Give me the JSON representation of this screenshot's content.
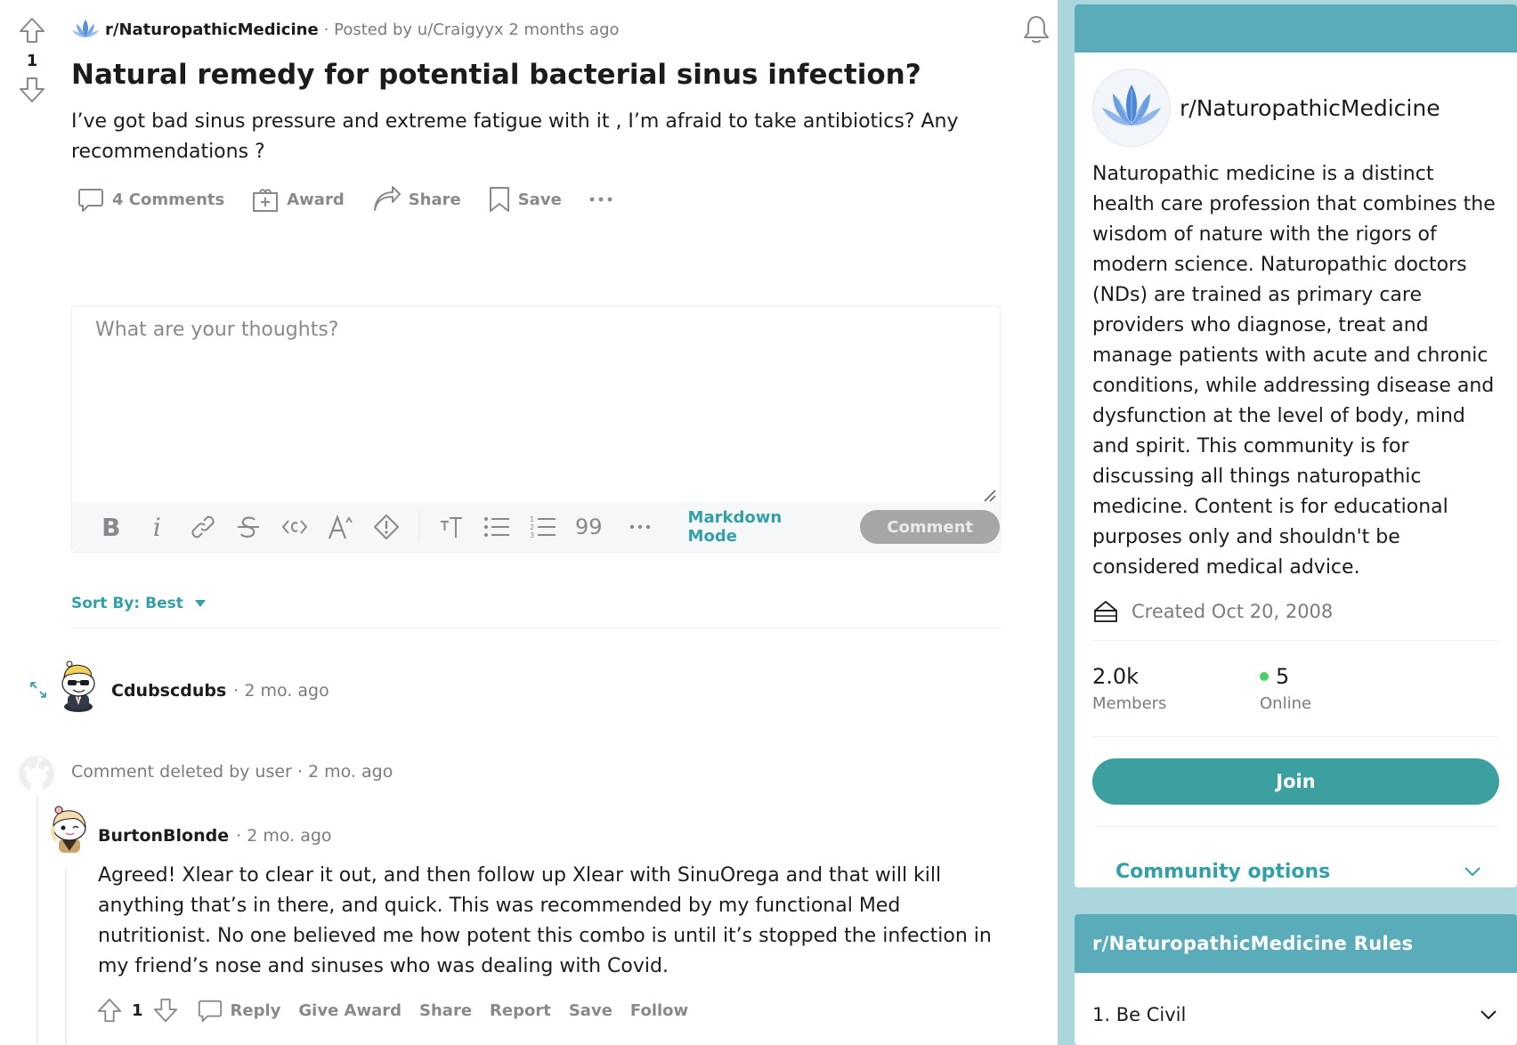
{
  "post": {
    "score": "1",
    "subreddit": "r/NaturopathicMedicine",
    "posted_by": "· Posted by u/Craigyyx 2 months ago",
    "title": "Natural remedy for potential bacterial sinus infection?",
    "body": "I’ve got bad sinus pressure and extreme fatigue with it , I’m afraid to take antibiotics? Any recommendations ?",
    "actions": {
      "comments": "4 Comments",
      "award": "Award",
      "share": "Share",
      "save": "Save"
    }
  },
  "editor": {
    "placeholder": "What are your thoughts?",
    "markdown_mode": "Markdown Mode",
    "comment_button": "Comment",
    "quote_glyph": "99"
  },
  "sort": {
    "label": "Sort By: Best"
  },
  "comments": [
    {
      "author": "Cdubscdubs",
      "time": "· 2 mo. ago"
    },
    {
      "deleted_text": "Comment deleted by user",
      "time": "· 2 mo. ago"
    },
    {
      "author": "BurtonBlonde",
      "time": "· 2 mo. ago",
      "body": "Agreed! Xlear to clear it out, and then follow up Xlear with SinuOrega and that will kill anything that’s in there, and quick. This was recommended by my functional Med nutritionist. No one believed me how potent this combo is until it’s stopped the infection in my friend’s nose and sinuses who was dealing with Covid.",
      "score": "1",
      "actions": {
        "reply": "Reply",
        "give_award": "Give Award",
        "share": "Share",
        "report": "Report",
        "save": "Save",
        "follow": "Follow"
      }
    }
  ],
  "sidebar": {
    "about": {
      "name": "r/NaturopathicMedicine",
      "description": "Naturopathic medicine is a distinct health care profession that combines the wisdom of nature with the rigors of modern science. Naturopathic doctors (NDs) are trained as primary care providers who diagnose, treat and manage patients with acute and chronic conditions, while addressing disease and dysfunction at the level of body, mind and spirit. This community is for discussing all things naturopathic medicine. Content is for educational purposes only and shouldn't be considered medical advice.",
      "created": "Created Oct 20, 2008",
      "members_value": "2.0k",
      "members_label": "Members",
      "online_value": "5",
      "online_label": "Online",
      "join": "Join",
      "community_options": "Community options"
    },
    "rules": {
      "title": "r/NaturopathicMedicine Rules",
      "items": [
        "1. Be Civil"
      ]
    }
  },
  "colors": {
    "accent": "#32a0a8",
    "header_band": "#5aacbb",
    "background": "#a9d7db",
    "online_dot": "#46d160"
  }
}
